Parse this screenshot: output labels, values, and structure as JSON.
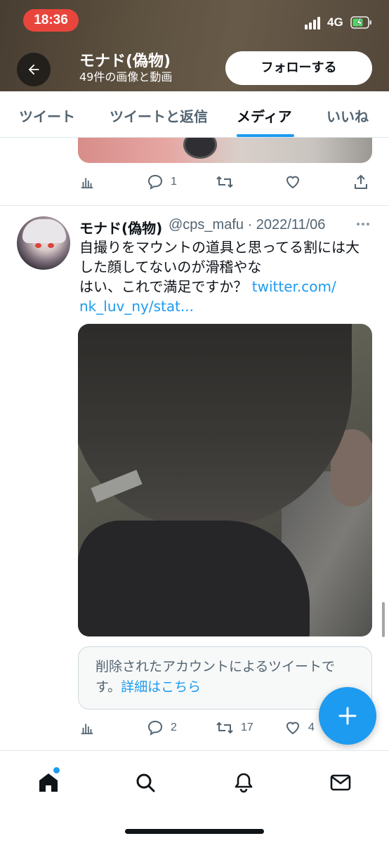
{
  "status_bar": {
    "time": "18:36",
    "network": "4G"
  },
  "header": {
    "title": "モナド(偽物)",
    "subtitle": "49件の画像と動画",
    "follow_label": "フォローする"
  },
  "tabs": [
    {
      "label": "ツイート",
      "active": false
    },
    {
      "label": "ツイートと返信",
      "active": false
    },
    {
      "label": "メディア",
      "active": true
    },
    {
      "label": "いいね",
      "active": false
    }
  ],
  "previous_tweet": {
    "reply_count": "1",
    "retweet_count": "",
    "like_count": ""
  },
  "tweet": {
    "name": "モナド(偽物)",
    "handle_date": "@cps_mafu · 2022/11/06",
    "text_line1": "自撮りをマウントの道具と思ってる割には大",
    "text_line2": "した顔してないのが滑稽やな",
    "text_line3": "はい、これで満足ですか？ ",
    "link_part1": "twitter.com/",
    "link_part2": "nk_luv_ny/stat...",
    "quote_text": "削除されたアカウントによるツイートです。",
    "quote_more": "詳細はこちら",
    "reply_count": "2",
    "retweet_count": "17",
    "like_count": "4"
  },
  "colors": {
    "accent": "#1d9bf0",
    "time_pill": "#e8463c",
    "secondary_text": "#536471"
  },
  "icons": [
    "back-arrow-icon",
    "signal-icon",
    "battery-icon",
    "analytics-icon",
    "reply-icon",
    "retweet-icon",
    "like-icon",
    "share-icon",
    "more-icon",
    "compose-plus-icon",
    "home-icon",
    "search-icon",
    "notifications-icon",
    "messages-icon"
  ]
}
